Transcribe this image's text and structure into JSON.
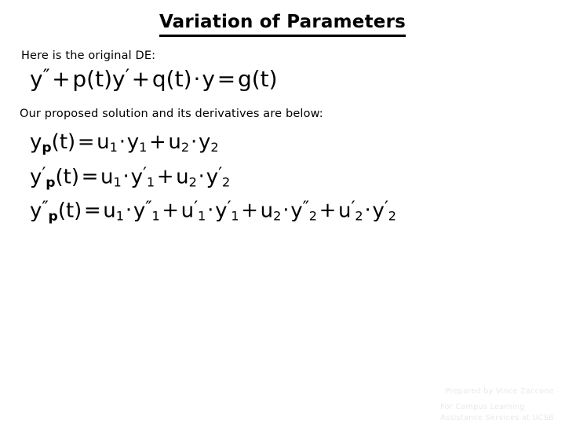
{
  "slide": {
    "title": "Variation of Parameters",
    "background_color": "#ffffff",
    "text_color": "#000000",
    "body": {
      "intro_original": "Here is the original DE:",
      "intro_solution": "Our proposed solution and its derivatives are below:"
    },
    "equations": {
      "original_de": {
        "lhs_y": "y",
        "lhs_y_prime2": "″",
        "plus1": "+",
        "p_of_t": "p(t)",
        "y2": "y",
        "y2_prime": "′",
        "plus2": "+",
        "q_of_t": "q(t)",
        "dot1": "·",
        "y3": "y",
        "equals": "=",
        "g_of_t": "g(t)",
        "plain": "y″ + p(t)y′ + q(t) · y = g(t)"
      },
      "solution": {
        "plain": "yₚ(t) = u₁ · y₁ + u₂ · y₂",
        "lhs_y": "y",
        "lhs_sub": "p",
        "lhs_arg": "(t)",
        "equals": "=",
        "u1": "u",
        "u1_sub": "1",
        "dot1": "·",
        "y1": "y",
        "y1_sub": "1",
        "plus": "+",
        "u2": "u",
        "u2_sub": "2",
        "dot2": "·",
        "y2": "y",
        "y2_sub": "2"
      },
      "first_derivative": {
        "plain": "y′ₚ(t) = u₁ · y′₁ + u₂ · y′₂",
        "lhs_y": "y",
        "lhs_prime": "′",
        "lhs_sub": "p",
        "lhs_arg": "(t)",
        "equals": "=",
        "u1": "u",
        "u1_sub": "1",
        "dot1": "·",
        "y1": "y",
        "y1_prime": "′",
        "y1_sub": "1",
        "plus": "+",
        "u2": "u",
        "u2_sub": "2",
        "dot2": "·",
        "y2": "y",
        "y2_prime": "′",
        "y2_sub": "2"
      },
      "second_derivative": {
        "plain": "y″ₚ(t) = u₁ · y″₁ + u′₁ · y′₁ + u₂ · y″₂ + u′₂ · y′₂",
        "lhs_y": "y",
        "lhs_prime": "″",
        "lhs_sub": "p",
        "lhs_arg": "(t)",
        "equals": "=",
        "t1_u": "u",
        "t1_u_sub": "1",
        "t1_dot": "·",
        "t1_y": "y",
        "t1_y_prime": "″",
        "t1_y_sub": "1",
        "plus1": "+",
        "t2_u": "u",
        "t2_u_prime": "′",
        "t2_u_sub": "1",
        "t2_dot": "·",
        "t2_y": "y",
        "t2_y_prime": "′",
        "t2_y_sub": "1",
        "plus2": "+",
        "t3_u": "u",
        "t3_u_sub": "2",
        "t3_dot": "·",
        "t3_y": "y",
        "t3_y_prime": "″",
        "t3_y_sub": "2",
        "plus3": "+",
        "t4_u": "u",
        "t4_u_prime": "′",
        "t4_u_sub": "2",
        "t4_dot": "·",
        "t4_y": "y",
        "t4_y_prime": "′",
        "t4_y_sub": "2"
      }
    },
    "footer": {
      "author_line": "Prepared by Vince Zaccone",
      "org_line_1": "For Campus Learning",
      "org_line_2": "Assistance Services at UCSB",
      "color": "#e9e9ed"
    }
  }
}
